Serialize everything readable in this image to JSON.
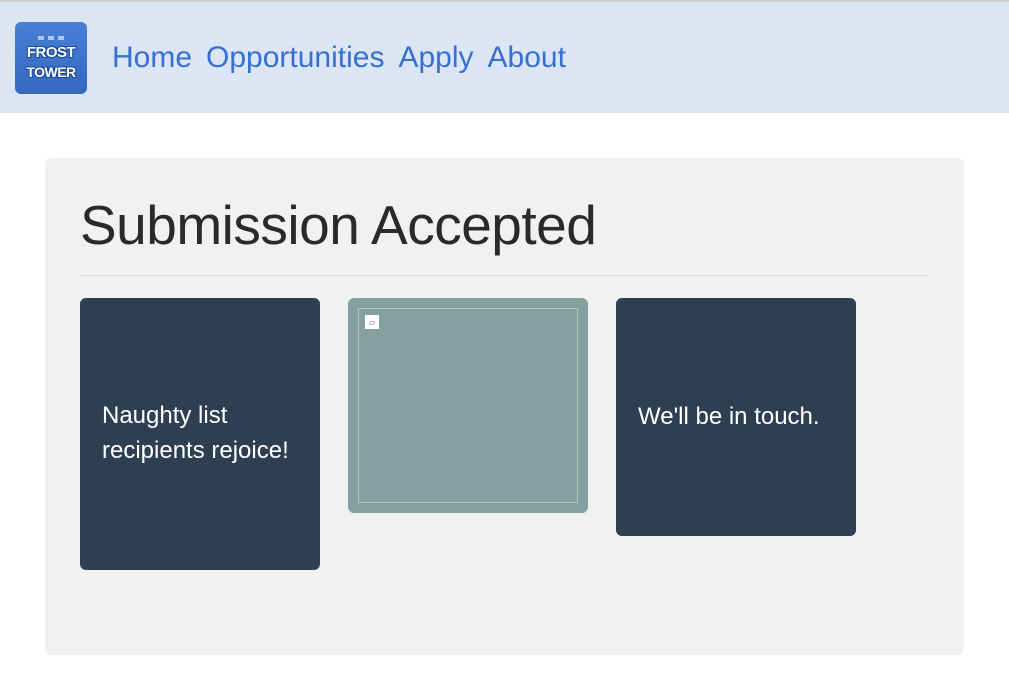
{
  "logo": {
    "line1": "FROST",
    "line2": "TOWER"
  },
  "nav": {
    "home": "Home",
    "opportunities": "Opportunities",
    "apply": "Apply",
    "about": "About"
  },
  "page": {
    "title": "Submission Accepted"
  },
  "cards": {
    "left": "Naughty list recipients rejoice!",
    "right": "We'll be in touch."
  }
}
